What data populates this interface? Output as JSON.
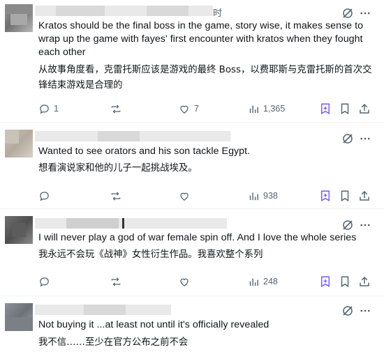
{
  "colors": {
    "text": "#0f1419",
    "muted": "#536471",
    "accent": "#7856ff",
    "divider": "#eff3f4"
  },
  "posts": [
    {
      "header_suffix": "时",
      "text_en": "Kratos should be the final boss in the game, story wise, it makes sense to wrap up the game with fayes' first encounter with kratos when they fought each other",
      "text_zh": "从故事角度看，克雷托斯应该是游戏的最终 Boss，以费耶斯与克雷托斯的首次交锋结束游戏是合理的",
      "replies": "1",
      "reposts": "",
      "likes": "7",
      "views": "1,365"
    },
    {
      "header_suffix": "",
      "text_en": "Wanted to see orators and his son tackle Egypt.",
      "text_zh": "想看演说家和他的儿子一起挑战埃及。",
      "replies": "",
      "reposts": "",
      "likes": "",
      "views": "938"
    },
    {
      "header_suffix": "",
      "text_en": "I will never play a god of war female spin off. And I love the whole series",
      "text_zh": "我永远不会玩《战神》女性衍生作品。我喜欢整个系列",
      "replies": "",
      "reposts": "",
      "likes": "",
      "views": "248"
    },
    {
      "header_suffix": "",
      "text_en": "Not buying it ...at least not until it's officially revealed",
      "text_zh": "我不信……至少在官方公布之前不会",
      "replies": "",
      "reposts": "",
      "likes": "",
      "views": ""
    }
  ]
}
